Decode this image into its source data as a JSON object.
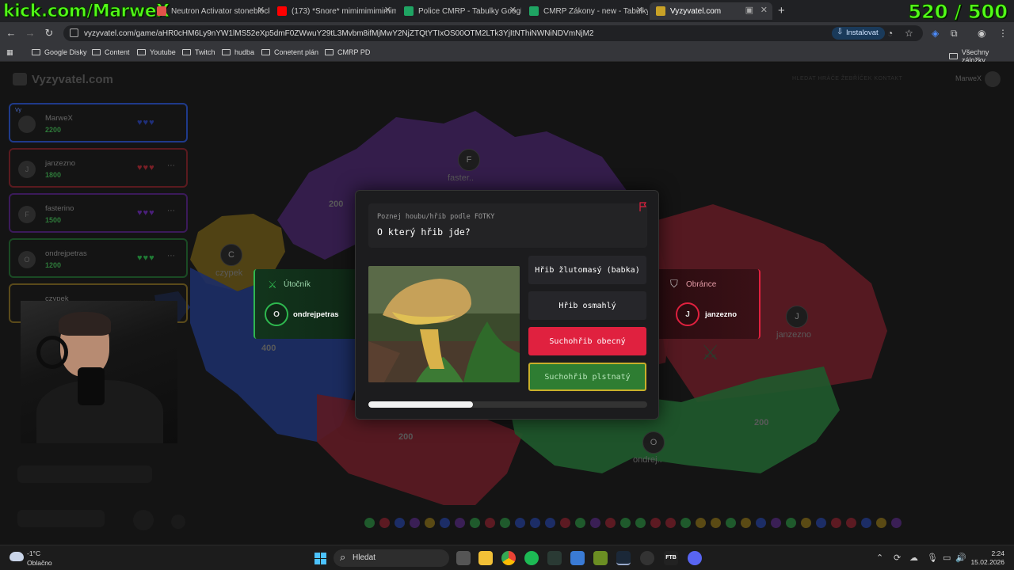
{
  "stream": {
    "title": "kick.com/MarweX",
    "counter": "520 / 500"
  },
  "tabs": [
    {
      "label": "Neutron Activator stoneblock 4",
      "color": "#e0534a"
    },
    {
      "label": "(173) *Snore* mimimimimimimi",
      "color": "#ff0000"
    },
    {
      "label": "Police CMRP - Tabulky Google",
      "color": "#1fa463"
    },
    {
      "label": "CMRP Zákony - new - Tabulky G",
      "color": "#1fa463"
    },
    {
      "label": "Vyzyvatel.com",
      "color": "#c9a227"
    }
  ],
  "address": {
    "url": "vyzyvatel.com/game/aHR0cHM6Ly9nYW1lMS52eXp5dmF0ZWwuY29tL3Mvbm8ifMjMwY2NjZTQtYTIxOS00OTM2LTk3YjItNThiNWNiNDVmNjM2",
    "install": "Instalovat"
  },
  "bookmarks": [
    "Google Disky",
    "Content",
    "Youtube",
    "Twitch",
    "hudba",
    "Conetent plán",
    "CMRP PD"
  ],
  "bookmarks_all": "Všechny záložky",
  "site": {
    "logo": "Vyzyvatel.com",
    "nav": "HLEDAT HRÁČE   ŽEBŘÍČEK   KONTAKT",
    "user": "MarweX"
  },
  "players": [
    {
      "name": "MarweX",
      "score": "2200",
      "hearts": "♥♥♥",
      "heart_color": "#1f2f7a",
      "border": "#1f3a8a",
      "avatar": ""
    },
    {
      "name": "janzezno",
      "score": "1800",
      "hearts": "♥♥♥",
      "heart_color": "#7a1f26",
      "border": "#5a1a1f",
      "avatar": "J"
    },
    {
      "name": "fasterino",
      "score": "1500",
      "hearts": "♥♥♥",
      "heart_color": "#4a1f7a",
      "border": "#3b1a5a",
      "avatar": "F"
    },
    {
      "name": "ondrejpetras",
      "score": "1200",
      "hearts": "♥♥♥",
      "heart_color": "#1f7a34",
      "border": "#1a4a24",
      "avatar": "O"
    },
    {
      "name": "czypek",
      "score": "",
      "hearts": "♥♥♥",
      "heart_color": "#6a5a1f",
      "border": "#5a4a1a",
      "avatar": "C"
    }
  ],
  "map": {
    "regions": [
      {
        "label": "faster..",
        "avatar": "F"
      },
      {
        "label": "czypek",
        "avatar": "C"
      },
      {
        "label": "janzezno",
        "avatar": "J"
      },
      {
        "label": "ondrej..",
        "avatar": "O"
      }
    ],
    "values": [
      "200",
      "400",
      "200",
      "200"
    ]
  },
  "attacker": {
    "title": "Útočník",
    "avatar": "O",
    "name": "ondrejpetras",
    "color": "#2eb84f"
  },
  "defender": {
    "title": "Obránce",
    "avatar": "J",
    "name": "janzezno",
    "color": "#e0213f"
  },
  "question": {
    "category": "Poznej houbu/hřib podle FOTKY",
    "text": "O který hřib jde?",
    "answers": [
      {
        "label": "Hřib žlutomasý (babka)",
        "state": "neutral"
      },
      {
        "label": "Hřib osmahlý",
        "state": "neutral"
      },
      {
        "label": "Suchohřib obecný",
        "state": "wrong"
      },
      {
        "label": "Suchohřib plstnatý",
        "state": "right"
      }
    ],
    "progress": 0.375
  },
  "taskbar": {
    "temp": "-1°C",
    "weather": "Oblačno",
    "search": "Hledat",
    "time": "2:24",
    "date": "15.02.2026"
  }
}
